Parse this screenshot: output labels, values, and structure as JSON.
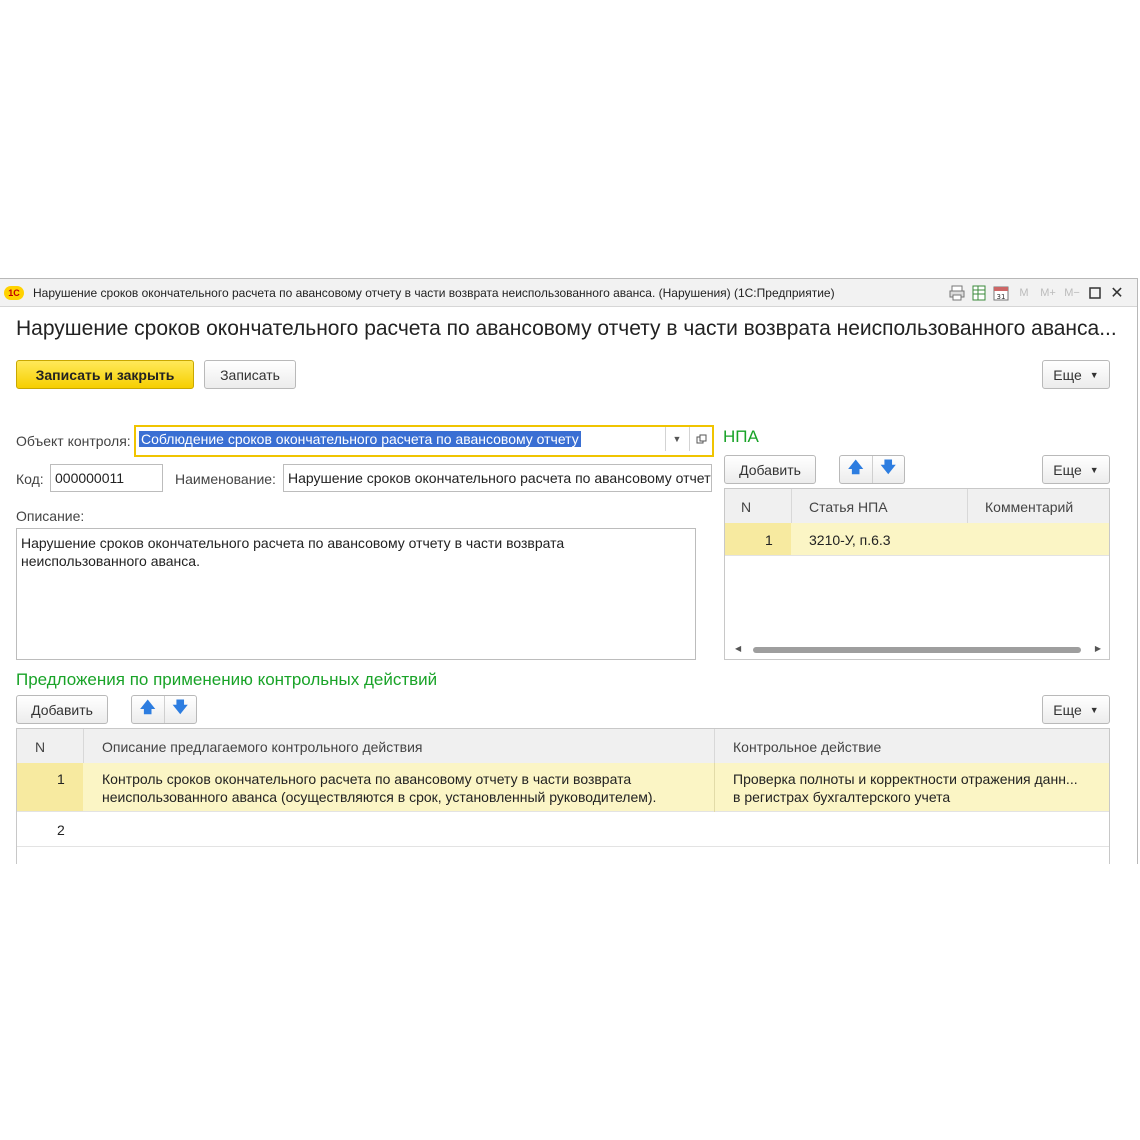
{
  "window": {
    "title": "Нарушение сроков окончательного расчета по авансовому отчету в части возврата неиспользованного аванса. (Нарушения)  (1С:Предприятие)",
    "logo": "1С",
    "icons": [
      "print-icon",
      "table-icon",
      "calendar-icon",
      "M",
      "M+",
      "M-",
      "maximize-icon",
      "close-icon"
    ],
    "mem_labels": [
      "M",
      "M+",
      "M−"
    ]
  },
  "form": {
    "title": "Нарушение сроков окончательного расчета по авансовому отчету в части возврата неиспользованного аванса...",
    "save_close_label": "Записать и закрыть",
    "save_label": "Записать",
    "more_label": "Еще"
  },
  "fields": {
    "object_label": "Объект контроля:",
    "object_value": "Соблюдение сроков окончательного расчета по авансовому отчету",
    "code_label": "Код:",
    "code_value": "000000011",
    "name_label": "Наименование:",
    "name_value": "Нарушение сроков окончательного расчета по авансовому отчету в части возврата неиспользованного аванса",
    "description_label": "Описание:",
    "description_value": "Нарушение сроков окончательного расчета по авансовому отчету в части возврата\nнеиспользованного аванса."
  },
  "npa": {
    "heading": "НПА",
    "add_label": "Добавить",
    "more_label": "Еще",
    "columns": [
      "N",
      "Статья НПА",
      "Комментарий"
    ],
    "rows": [
      {
        "n": "1",
        "article": "3210-У, п.6.3",
        "comment": ""
      }
    ]
  },
  "proposals": {
    "heading": "Предложения по применению контрольных действий",
    "add_label": "Добавить",
    "more_label": "Еще",
    "columns": [
      "N",
      "Описание предлагаемого контрольного действия",
      "Контрольное действие"
    ],
    "rows": [
      {
        "n": "1",
        "description_line1": "Контроль сроков окончательного расчета по авансовому отчету в части возврата",
        "description_line2": "неиспользованного аванса (осуществляются в срок, установленный руководителем).",
        "action_line1": "Проверка полноты и корректности отражения данн...",
        "action_line2": "в регистрах бухгалтерского учета"
      },
      {
        "n": "2",
        "description_line1": "",
        "description_line2": "",
        "action_line1": "",
        "action_line2": ""
      }
    ]
  },
  "colors": {
    "accent_yellow": "#f6cf00",
    "heading_green": "#19a328",
    "selection_blue": "#3a6fd3",
    "row_highlight": "#fbf5c5"
  }
}
